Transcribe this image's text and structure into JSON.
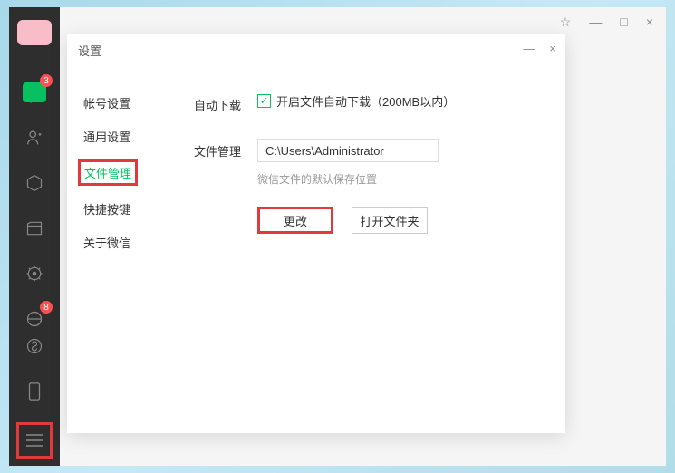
{
  "sidebar": {
    "chats_badge": "3",
    "moments_badge": "8"
  },
  "main_window": {
    "pin": "⚘",
    "minimize": "—",
    "maximize": "□",
    "close": "×"
  },
  "dialog": {
    "title": "设置",
    "minimize": "—",
    "close": "×",
    "nav": {
      "account": "帐号设置",
      "general": "通用设置",
      "file": "文件管理",
      "shortcut": "快捷按键",
      "about": "关于微信"
    },
    "content": {
      "auto_download_label": "自动下载",
      "auto_download_text": "开启文件自动下载（200MB以内）",
      "file_mgmt_label": "文件管理",
      "path_value": "C:\\Users\\Administrator",
      "path_hint": "微信文件的默认保存位置",
      "change_btn": "更改",
      "open_btn": "打开文件夹"
    }
  }
}
